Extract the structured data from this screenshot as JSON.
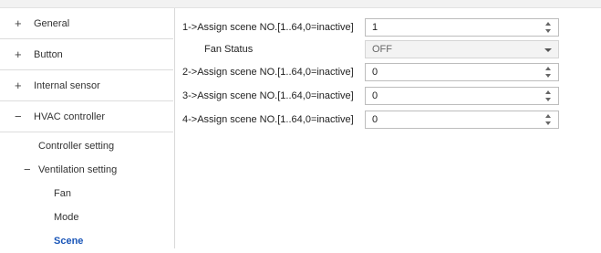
{
  "sidebar": {
    "items": [
      {
        "symbol": "+",
        "label": "General"
      },
      {
        "symbol": "+",
        "label": "Button"
      },
      {
        "symbol": "+",
        "label": "Internal sensor"
      },
      {
        "symbol": "−",
        "label": "HVAC controller"
      }
    ],
    "subitems": {
      "controller_setting": "Controller setting",
      "ventilation_symbol": "−",
      "ventilation_setting": "Ventilation setting",
      "fan": "Fan",
      "mode": "Mode",
      "scene": "Scene"
    }
  },
  "params": [
    {
      "label": "1->Assign scene NO.[1..64,0=inactive]",
      "value": "1",
      "control": "spinner"
    },
    {
      "label": "Fan Status",
      "value": "OFF",
      "control": "dropdown"
    },
    {
      "label": "2->Assign scene NO.[1..64,0=inactive]",
      "value": "0",
      "control": "spinner"
    },
    {
      "label": "3->Assign scene NO.[1..64,0=inactive]",
      "value": "0",
      "control": "spinner"
    },
    {
      "label": "4->Assign scene NO.[1..64,0=inactive]",
      "value": "0",
      "control": "spinner"
    }
  ],
  "colors": {
    "selected_text": "#1a56b8",
    "border": "#bdbdbd"
  }
}
